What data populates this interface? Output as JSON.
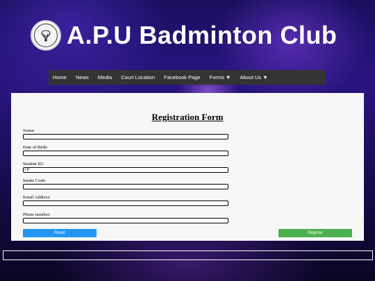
{
  "header": {
    "title": "A.P.U Badminton Club",
    "logo_icon": "club-crest-icon"
  },
  "nav": {
    "items": [
      {
        "label": "Home"
      },
      {
        "label": "News"
      },
      {
        "label": "Media"
      },
      {
        "label": "Court Location"
      },
      {
        "label": "Facebook Page"
      },
      {
        "label": "Forms ▼"
      },
      {
        "label": "About Us ▼"
      }
    ]
  },
  "form": {
    "title": "Registration Form",
    "fields": [
      {
        "label": "Name:",
        "value": ""
      },
      {
        "label": "Date of Birth:",
        "value": ""
      },
      {
        "label": "Student ID:",
        "value": "TP"
      },
      {
        "label": "Intake Code:",
        "value": ""
      },
      {
        "label": "Email Address:",
        "value": ""
      },
      {
        "label": "Phone number:",
        "value": ""
      }
    ],
    "reset_label": "Reset",
    "register_label": "Register"
  },
  "colors": {
    "nav_bg": "#333333",
    "reset_button": "#2196f3",
    "register_button": "#4caf50"
  }
}
